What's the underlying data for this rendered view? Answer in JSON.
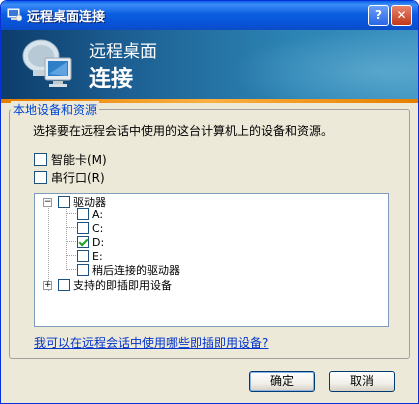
{
  "window": {
    "title": "远程桌面连接",
    "help_glyph": "?",
    "close_glyph": "✕"
  },
  "banner": {
    "line1": "远程桌面",
    "line2": "连接"
  },
  "group": {
    "title": "本地设备和资源",
    "description": "选择要在远程会话中使用的这台计算机上的设备和资源。"
  },
  "options": [
    {
      "label": "智能卡(M)",
      "checked": false
    },
    {
      "label": "串行口(R)",
      "checked": false
    }
  ],
  "tree": {
    "drives": {
      "label": "驱动器",
      "expander": "⊟",
      "checked": false,
      "children": [
        {
          "label": "A:",
          "checked": false
        },
        {
          "label": "C:",
          "checked": false
        },
        {
          "label": "D:",
          "checked": true
        },
        {
          "label": "E:",
          "checked": false
        },
        {
          "label": "稍后连接的驱动器",
          "checked": false
        }
      ]
    },
    "pnp": {
      "label": "支持的即插即用设备",
      "expander": "⊞",
      "checked": false
    }
  },
  "help_link": "我可以在远程会话中使用哪些即插即用设备?",
  "buttons": {
    "ok": "确定",
    "cancel": "取消"
  },
  "colors": {
    "titlebar": "#0b5ee0",
    "link": "#0033cc",
    "accent": "#e67e00",
    "banner": "#1d5f92"
  }
}
